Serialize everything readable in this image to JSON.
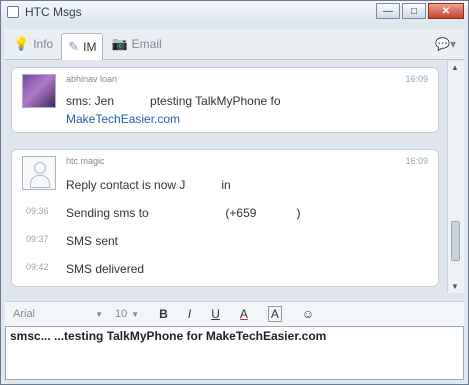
{
  "window": {
    "title": "HTC Msgs"
  },
  "window_buttons": {
    "minimize": "—",
    "maximize": "□",
    "close": "✕"
  },
  "tabs": [
    {
      "label": "Info",
      "icon": "lightbulb-icon"
    },
    {
      "label": "IM",
      "icon": "pencil-icon"
    },
    {
      "label": "Email",
      "icon": "camera-icon"
    }
  ],
  "tab_right": {
    "icon": "chat-bubbles-icon",
    "glyph": "💬▾"
  },
  "messages": [
    {
      "sender": "abhinav loan",
      "time": "16:09",
      "text_part1": "sms: Jen",
      "text_part2": "ptesting TalkMyPhone fo",
      "text_link": "MakeTechEasier.com"
    },
    {
      "sender": "htc magic",
      "time": "16:09",
      "line1_part1": "Reply contact is now J",
      "line1_part2": "in",
      "entries": [
        {
          "time": "09:36",
          "part1": "Sending sms to",
          "part2": "(+659",
          "part3": ")"
        },
        {
          "time": "09:37",
          "text": "SMS sent"
        },
        {
          "time": "09:42",
          "text": "SMS delivered"
        }
      ]
    }
  ],
  "format_toolbar": {
    "font": "Arial",
    "size": "10",
    "bold": "B",
    "italic": "I",
    "underline": "U",
    "font_color": "A",
    "highlight": "A",
    "emoticon": "☺"
  },
  "input": {
    "value": "smsc... ...testing TalkMyPhone for MakeTechEasier.com"
  }
}
